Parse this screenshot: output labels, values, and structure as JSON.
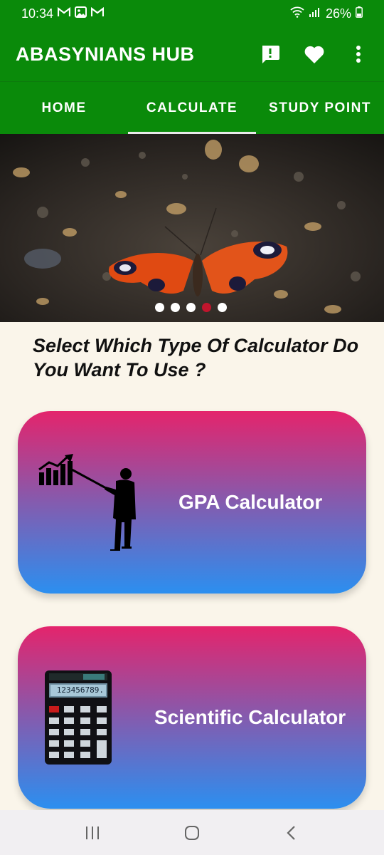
{
  "status": {
    "time": "10:34",
    "battery": "26%",
    "left_icons": [
      "gmail-icon",
      "gallery-icon",
      "gmail-icon"
    ],
    "right_icons": [
      "wifi-icon",
      "signal-icon",
      "battery-icon"
    ]
  },
  "app_bar": {
    "title": "ABASYNIANS HUB",
    "actions": [
      "feedback-icon",
      "favorite-icon",
      "more-vert-icon"
    ]
  },
  "tabs": [
    {
      "label": "HOME",
      "active": false
    },
    {
      "label": "CALCULATE",
      "active": true
    },
    {
      "label": "STUDY POINT",
      "active": false
    }
  ],
  "banner": {
    "slides": 5,
    "active_slide": 4
  },
  "main": {
    "prompt": "Select Which Type Of Calculator Do You Want To Use ?",
    "cards": [
      {
        "label": "GPA Calculator",
        "icon": "presentation-chart-icon"
      },
      {
        "label": "Scientific Calculator",
        "icon": "calculator-icon",
        "display": "123456789."
      }
    ]
  },
  "nav": [
    "recents-icon",
    "home-icon",
    "back-icon"
  ],
  "colors": {
    "app_green": "#0a8a0a",
    "background": "#faf5ea",
    "card_gradient_top": "#e4246c",
    "card_gradient_bottom": "#2b8ff0",
    "dot_active": "#c0152d"
  }
}
